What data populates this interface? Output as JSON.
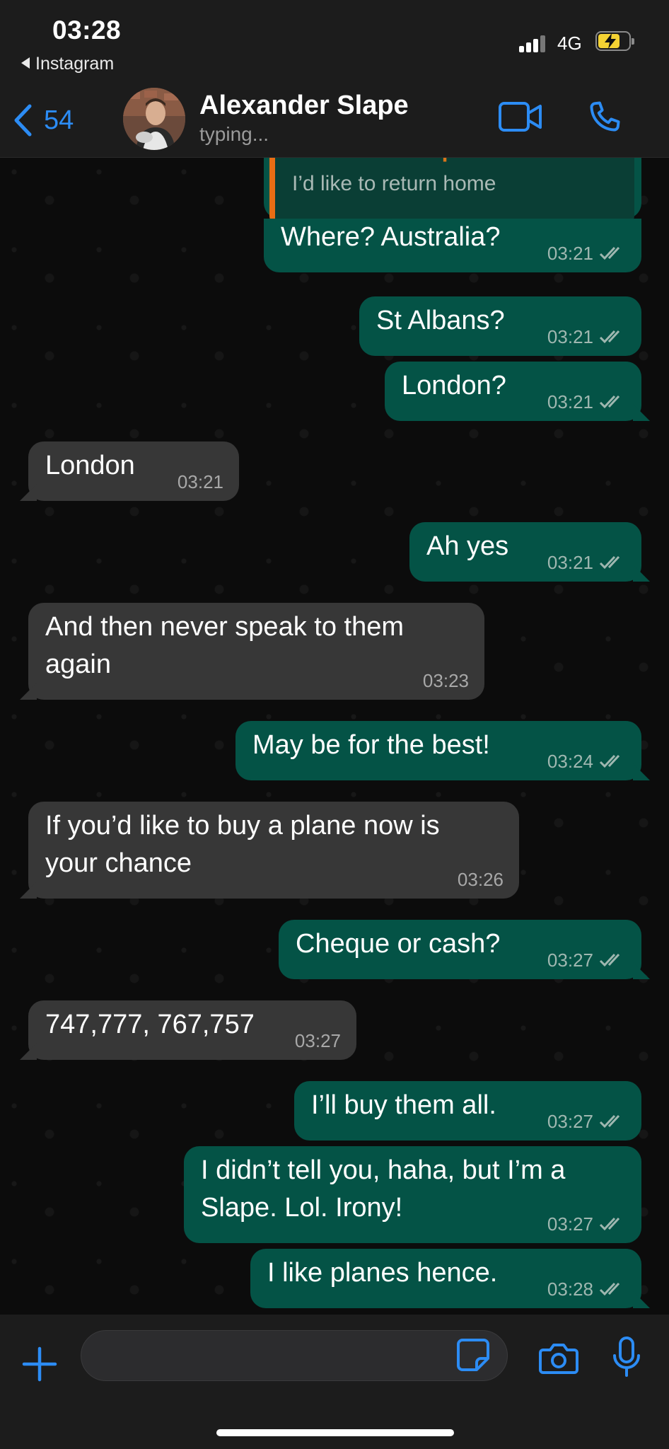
{
  "status_bar": {
    "time": "03:28",
    "back_app": "Instagram",
    "network": "4G",
    "battery_state": "charging"
  },
  "header": {
    "back_count": "54",
    "contact_name": "Alexander Slape",
    "contact_status": "typing..."
  },
  "quoted": {
    "name": "Alexander Slape",
    "text": "I’d like to return home"
  },
  "messages": [
    {
      "dir": "out",
      "text": "Where? Australia?",
      "time": "03:21",
      "read": true
    },
    {
      "dir": "out",
      "text": "St Albans?",
      "time": "03:21",
      "read": true
    },
    {
      "dir": "out",
      "text": "London?",
      "time": "03:21",
      "read": true
    },
    {
      "dir": "in",
      "text": "London",
      "time": "03:21"
    },
    {
      "dir": "out",
      "text": "Ah yes",
      "time": "03:21",
      "read": true
    },
    {
      "dir": "in",
      "text": "And then never speak to them\nagain",
      "time": "03:23"
    },
    {
      "dir": "out",
      "text": "May be for the best!",
      "time": "03:24",
      "read": true
    },
    {
      "dir": "in",
      "text": "If you’d like to buy a plane now is\nyour chance",
      "time": "03:26"
    },
    {
      "dir": "out",
      "text": "Cheque or cash?",
      "time": "03:27",
      "read": true
    },
    {
      "dir": "in",
      "text": "747,777, 767,757",
      "time": "03:27"
    },
    {
      "dir": "out",
      "text": "I’ll buy them all.",
      "time": "03:27",
      "read": true
    },
    {
      "dir": "out",
      "text": "I didn’t tell you, haha, but I’m a\nSlape. Lol. Irony!",
      "time": "03:27",
      "read": true
    },
    {
      "dir": "out",
      "text": "I like planes hence.",
      "time": "03:28",
      "read": true
    }
  ],
  "composer": {
    "placeholder": ""
  },
  "colors": {
    "accent": "#2c8cf4",
    "outgoing_bubble": "#045346",
    "incoming_bubble": "#373737",
    "quote_name": "#d9731b",
    "battery": "#f4d233"
  },
  "icons": [
    "back-chevron-icon",
    "video-call-icon",
    "phone-icon",
    "plus-icon",
    "sticker-icon",
    "camera-icon",
    "microphone-icon",
    "read-receipt-icon"
  ]
}
